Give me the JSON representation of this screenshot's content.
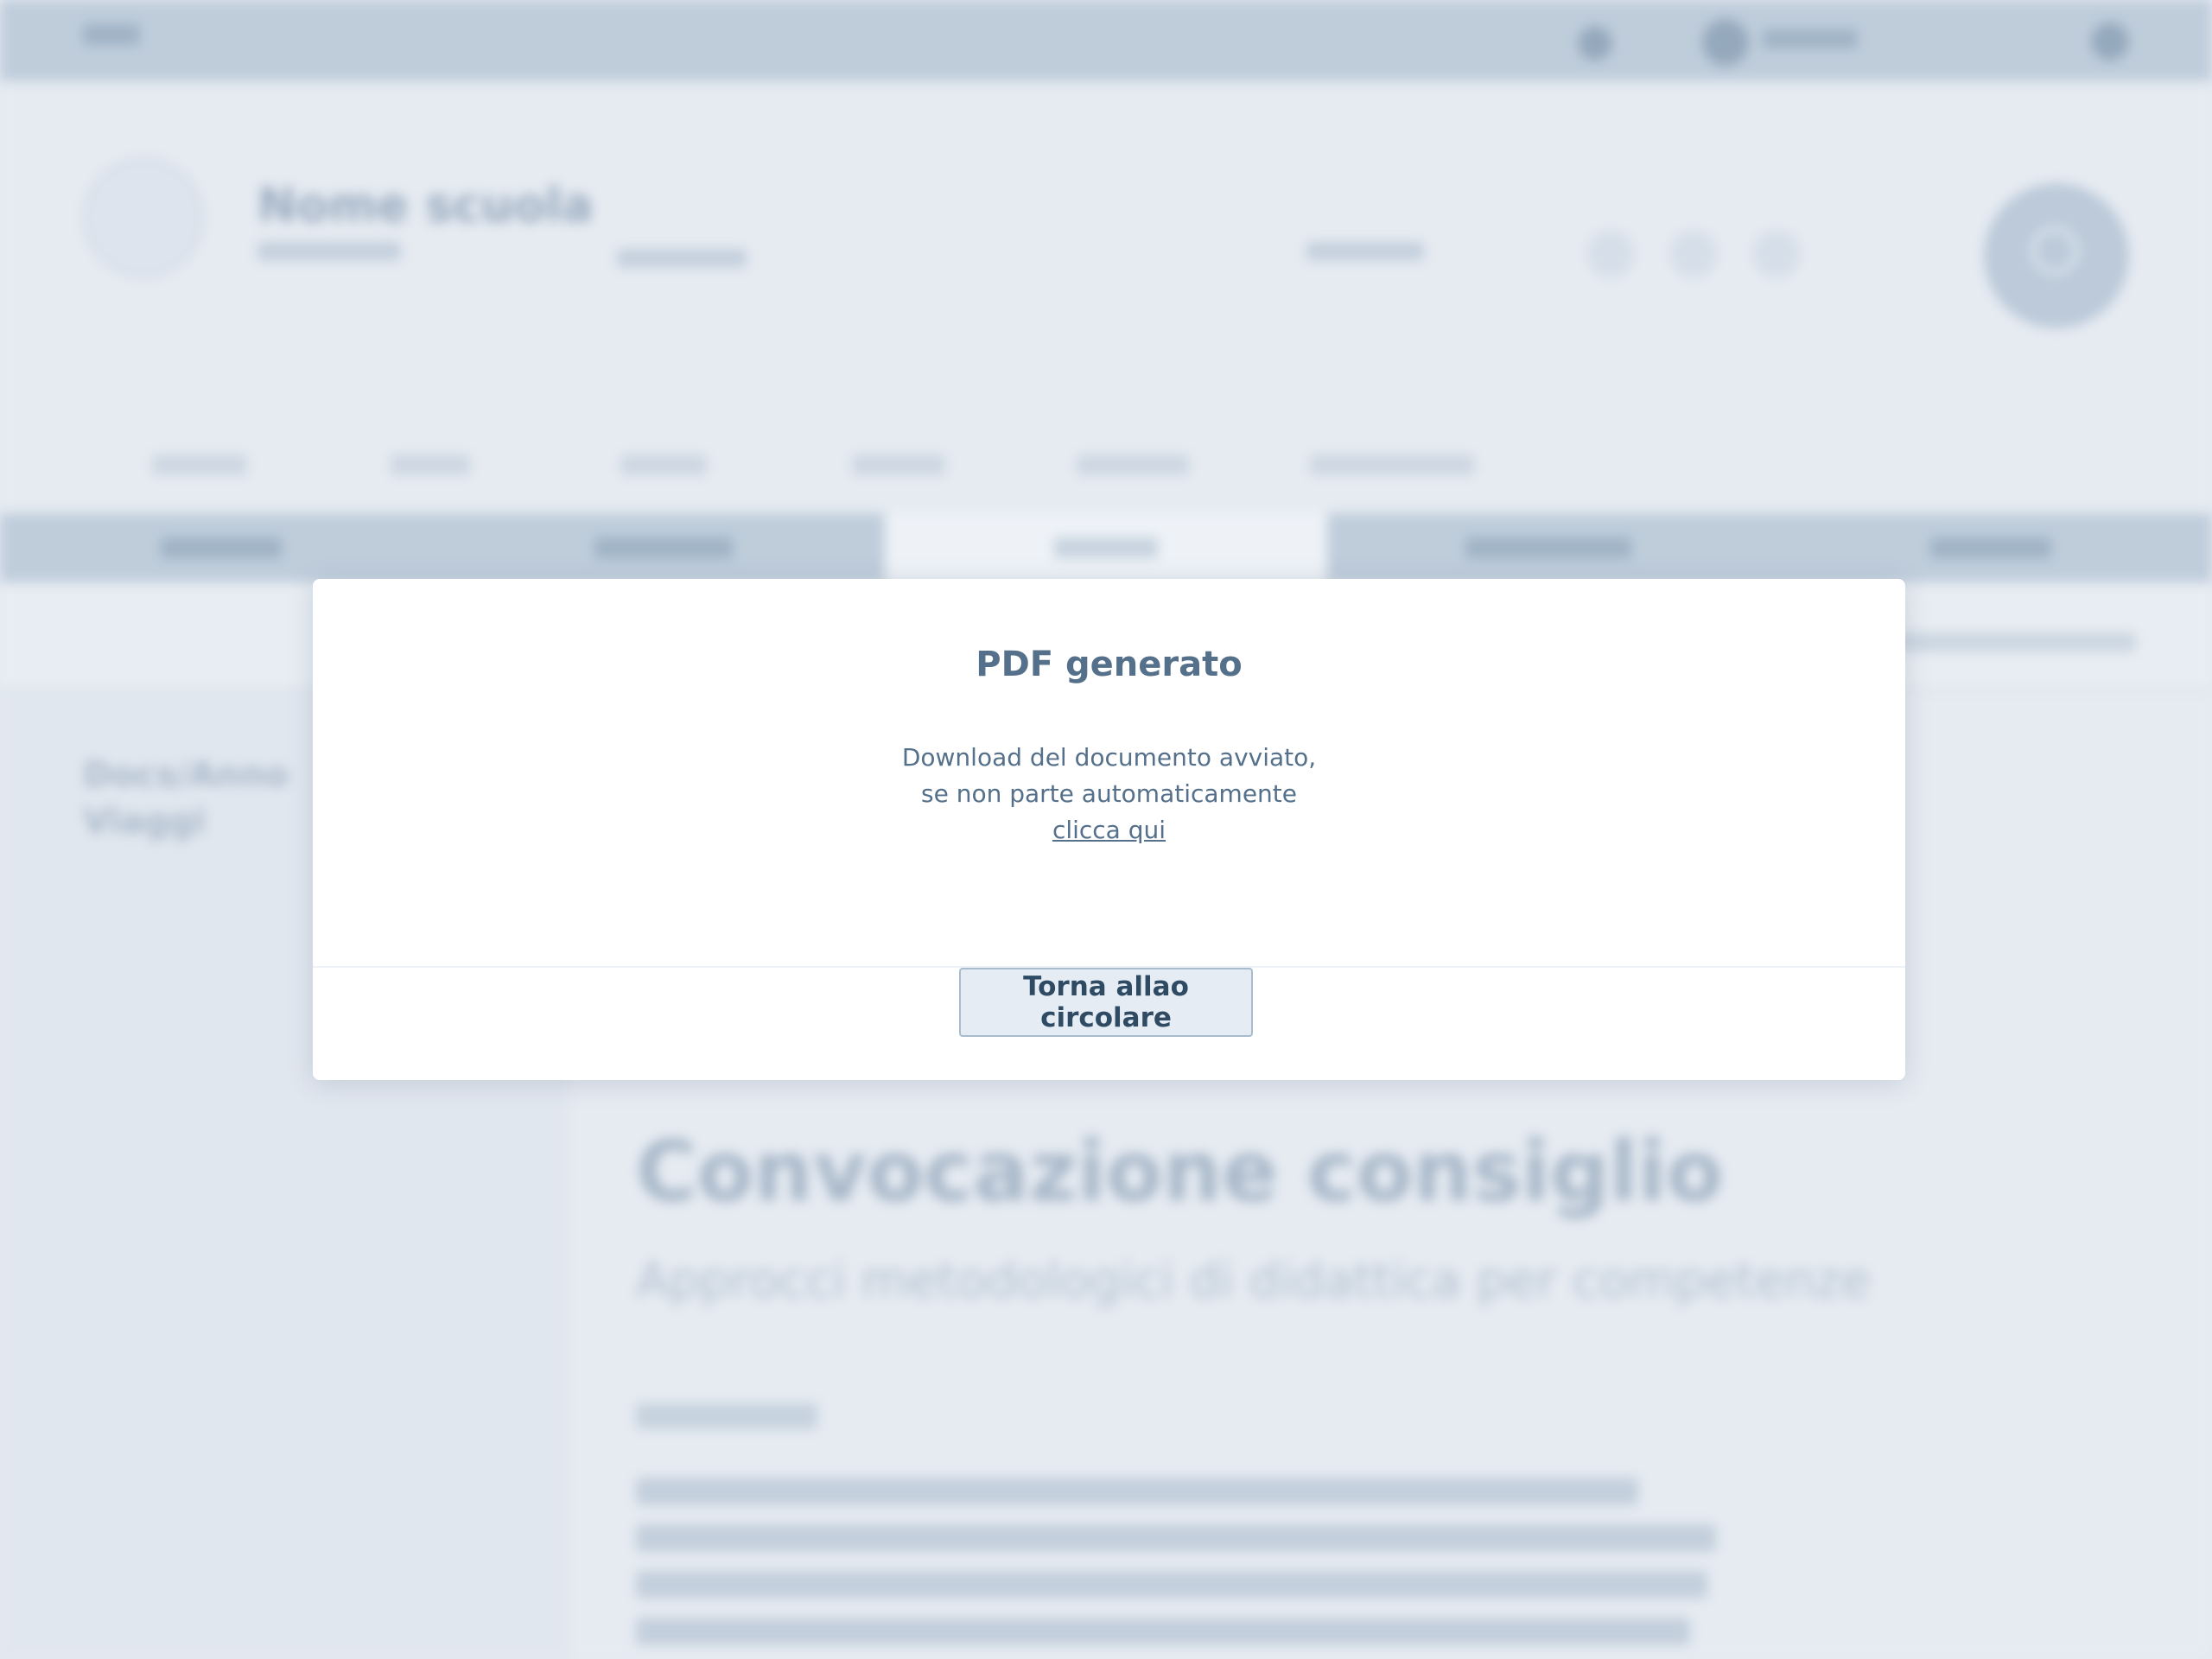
{
  "background": {
    "school_name": "Nome scuola",
    "sidebar_title_line1": "Docs/Anno",
    "sidebar_title_line2": "Viaggi",
    "main_title": "Convocazione consiglio",
    "main_subtitle": "Approcci metodologici di didattica per competenze"
  },
  "modal": {
    "title": "PDF generato",
    "body_line1": "Download del documento avviato,",
    "body_line2": "se non parte automaticamente",
    "link_label": "clicca qui",
    "button_label": "Torna allao circolare"
  },
  "colors": {
    "overlay": "#e4e9f1",
    "modal_bg": "#ffffff",
    "text": "#55708a",
    "button_text": "#2f4b63",
    "button_border": "#a9bccd"
  }
}
